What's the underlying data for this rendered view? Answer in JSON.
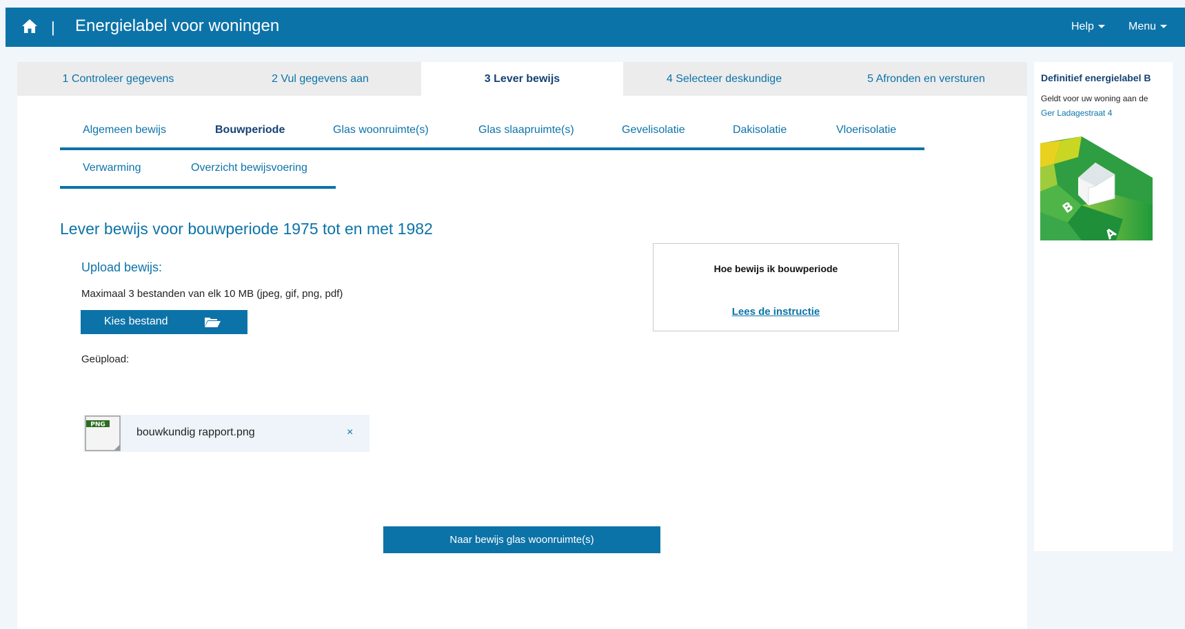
{
  "header": {
    "title": "Energielabel voor woningen",
    "separator": "|",
    "help_label": "Help",
    "menu_label": "Menu",
    "home_icon": "home-icon"
  },
  "steps": [
    {
      "label": "1 Controleer gegevens"
    },
    {
      "label": "2 Vul gegevens aan"
    },
    {
      "label": "3 Lever bewijs"
    },
    {
      "label": "4 Selecteer deskundige"
    },
    {
      "label": "5 Afronden en versturen"
    }
  ],
  "subtabs": [
    {
      "label": "Algemeen bewijs"
    },
    {
      "label": "Bouwperiode"
    },
    {
      "label": "Glas woonruimte(s)"
    },
    {
      "label": "Glas slaapruimte(s)"
    },
    {
      "label": "Gevelisolatie"
    },
    {
      "label": "Dakisolatie"
    },
    {
      "label": "Vloerisolatie"
    },
    {
      "label": "Verwarming"
    },
    {
      "label": "Overzicht bewijsvoering"
    }
  ],
  "main": {
    "heading": "Lever bewijs voor bouwperiode 1975 tot en met 1982",
    "upload_label": "Upload bewijs:",
    "max_text": "Maximaal 3 bestanden van elk 10 MB (jpeg, gif, png, pdf)",
    "choose_button": "Kies bestand",
    "uploaded_label": "Geüpload:",
    "file": {
      "type_badge": "PNG",
      "name": "bouwkundig rapport.png",
      "remove": "×"
    },
    "info_box": {
      "title": "Hoe bewijs ik bouwperiode",
      "link": "Lees de instructie"
    },
    "next_button": "Naar bewijs glas woonruimte(s)"
  },
  "sidebar": {
    "title": "Definitief energielabel B",
    "description": "Geldt voor uw woning aan de",
    "address": "Ger Ladagestraat 4",
    "label_letters": [
      "B",
      "A"
    ]
  },
  "colors": {
    "primary": "#0c73a8",
    "dark_blue": "#154273",
    "tab_bg": "#ececec",
    "page_bg": "#f1f6fb"
  }
}
